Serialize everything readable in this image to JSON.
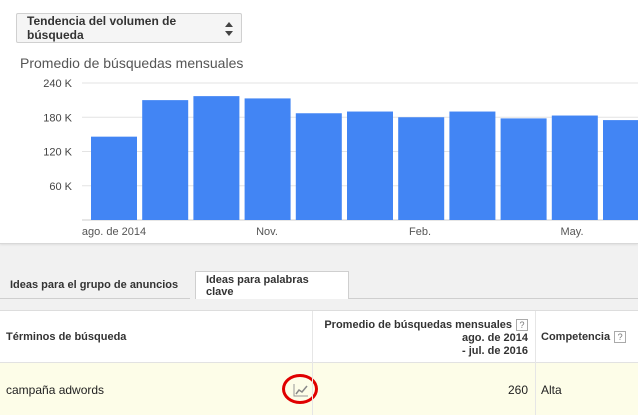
{
  "dropdown": {
    "label": "Tendencia del volumen de búsqueda"
  },
  "chart_title": "Promedio de búsquedas mensuales",
  "chart_data": {
    "type": "bar",
    "categories": [
      "ago. de 2014",
      "",
      "",
      "Nov.",
      "",
      "",
      "Feb.",
      "",
      "",
      "May.",
      ""
    ],
    "values": [
      146000,
      210000,
      217000,
      213000,
      187000,
      190000,
      180000,
      190000,
      178000,
      183000,
      175000
    ],
    "x_tick_labels": [
      "ago. de 2014",
      "Nov.",
      "Feb.",
      "May."
    ],
    "y_ticks": [
      "240 K",
      "180 K",
      "120 K",
      "60 K"
    ],
    "y_tick_values": [
      240000,
      180000,
      120000,
      60000
    ],
    "ylim": [
      0,
      240000
    ],
    "grid": true,
    "colors": {
      "bar": "#4285f4",
      "grid": "#e3e3e3"
    }
  },
  "tabs": [
    {
      "label": "Ideas para el grupo de anuncios",
      "active": false
    },
    {
      "label": "Ideas para palabras clave",
      "active": true
    }
  ],
  "table": {
    "headers": {
      "terms": "Términos de búsqueda",
      "avg_line1": "Promedio de búsquedas mensuales",
      "avg_line2": "ago. de 2014",
      "avg_line3": "- jul. de 2016",
      "competition": "Competencia",
      "help": "?"
    },
    "rows": [
      {
        "term": "campaña adwords",
        "avg": "260",
        "competition": "Alta",
        "trend_icon": "line-chart-icon"
      }
    ]
  }
}
